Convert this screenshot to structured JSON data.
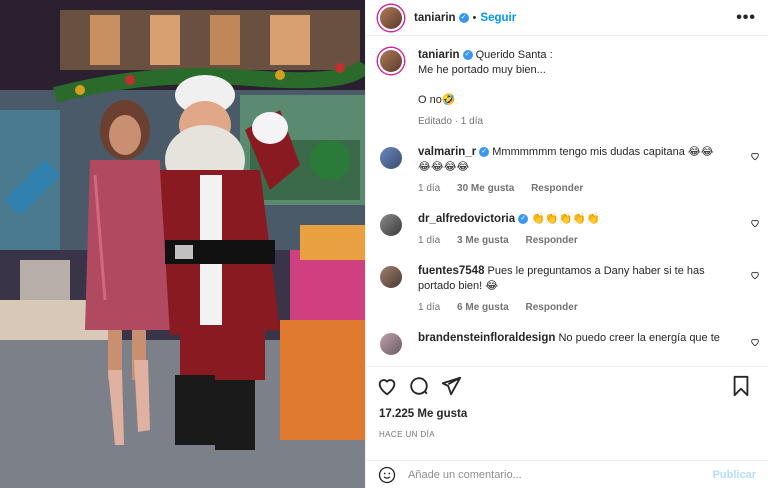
{
  "header": {
    "username": "taniarin",
    "follow_label": "Seguir",
    "more": "•••"
  },
  "caption": {
    "username": "taniarin",
    "line1": "Querido Santa :",
    "line2": "Me he portado muy bien...",
    "line3": "O no🤣",
    "meta": "Editado · 1 día"
  },
  "comments": [
    {
      "username": "valmarin_r",
      "verified": true,
      "text": "Mmmmmmm tengo mis dudas capitana 😂😂",
      "text2": "😂😂😂😂",
      "time": "1 día",
      "likes": "30 Me gusta",
      "reply": "Responder"
    },
    {
      "username": "dr_alfredovictoria",
      "verified": true,
      "text": "👏👏👏👏👏",
      "time": "1 día",
      "likes": "3 Me gusta",
      "reply": "Responder"
    },
    {
      "username": "fuentes7548",
      "verified": false,
      "text": "Pues le preguntamos a Dany haber si te has",
      "text2": "portado bien! 😂",
      "time": "1 día",
      "likes": "6 Me gusta",
      "reply": "Responder"
    },
    {
      "username": "brandensteinfloraldesign",
      "verified": false,
      "text": "No puedo creer la energía que te"
    }
  ],
  "post": {
    "likes": "17.225 Me gusta",
    "time": "HACE UN DÍA"
  },
  "add_comment": {
    "placeholder": "Añade un comentario...",
    "publish": "Publicar"
  },
  "icons": [
    "heart-icon",
    "comment-icon",
    "share-icon",
    "bookmark-icon",
    "emoji-icon"
  ]
}
